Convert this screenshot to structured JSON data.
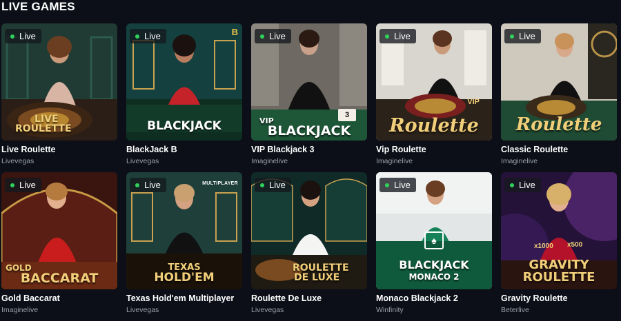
{
  "section": {
    "title": "LIVE GAMES"
  },
  "live_label": "Live",
  "colors": {
    "live_dot": "#2fd15a",
    "background": "#0c0f17",
    "provider_text": "#9aa0aa"
  },
  "games": [
    {
      "name": "Live Roulette",
      "provider": "Livevegas",
      "logo_lines": [
        "LIVE",
        "ROULETTE"
      ],
      "corner": ""
    },
    {
      "name": "BlackJack B",
      "provider": "Livevegas",
      "logo_lines": [
        "BLACKJACK"
      ],
      "corner": "B"
    },
    {
      "name": "VIP Blackjack 3",
      "provider": "Imaginelive",
      "logo_lines": [
        "VIP",
        "BLACKJACK"
      ],
      "corner": "3"
    },
    {
      "name": "Vip Roulette",
      "provider": "Imaginelive",
      "logo_lines": [
        "VIP",
        "Roulette"
      ],
      "corner": ""
    },
    {
      "name": "Classic Roulette",
      "provider": "Imaginelive",
      "logo_lines": [
        "Roulette"
      ],
      "corner": ""
    },
    {
      "name": "Gold Baccarat",
      "provider": "Imaginelive",
      "logo_lines": [
        "GOLD",
        "BACCARAT"
      ],
      "corner": ""
    },
    {
      "name": "Texas Hold'em Multiplayer",
      "provider": "Livevegas",
      "logo_lines": [
        "TEXAS",
        "HOLD'EM"
      ],
      "corner": "MULTIPLAYER"
    },
    {
      "name": "Roulette De Luxe",
      "provider": "Livevegas",
      "logo_lines": [
        "ROULETTE",
        "DE LUXE"
      ],
      "corner": ""
    },
    {
      "name": "Monaco Blackjack 2",
      "provider": "Winfinity",
      "logo_lines": [
        "BLACKJACK",
        "MONACO 2"
      ],
      "corner": ""
    },
    {
      "name": "Gravity Roulette",
      "provider": "Beterlive",
      "logo_lines": [
        "x1000",
        "x500",
        "GRAVITY",
        "ROULETTE"
      ],
      "corner": ""
    }
  ]
}
